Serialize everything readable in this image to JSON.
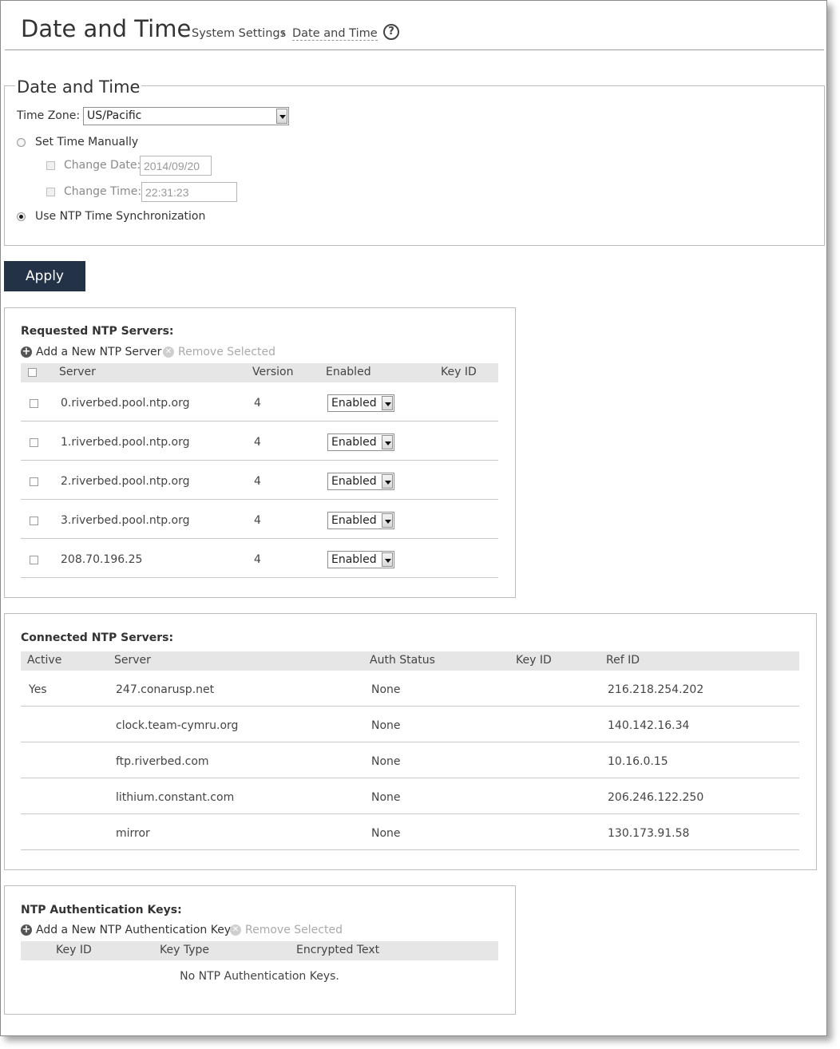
{
  "header": {
    "title": "Date and Time",
    "breadcrumb_parent": "System Settings",
    "breadcrumb_separator": "›",
    "breadcrumb_current": "Date and Time",
    "help_symbol": "?"
  },
  "date_time": {
    "legend": "Date and Time",
    "time_zone_label": "Time Zone:",
    "time_zone_value": "US/Pacific",
    "set_manually_label": "Set Time Manually",
    "change_date_label": "Change Date:",
    "change_date_value": "2014/09/20",
    "change_time_label": "Change Time:",
    "change_time_value": "22:31:23",
    "ntp_sync_label": "Use NTP Time Synchronization",
    "selected_mode": "ntp"
  },
  "apply_label": "Apply",
  "requested": {
    "title": "Requested NTP Servers:",
    "add_label": "Add a New NTP Server",
    "remove_label": "Remove Selected",
    "columns": [
      "Server",
      "Version",
      "Enabled",
      "Key ID"
    ],
    "rows": [
      {
        "server": "0.riverbed.pool.ntp.org",
        "version": "4",
        "enabled": "Enabled",
        "key_id": ""
      },
      {
        "server": "1.riverbed.pool.ntp.org",
        "version": "4",
        "enabled": "Enabled",
        "key_id": ""
      },
      {
        "server": "2.riverbed.pool.ntp.org",
        "version": "4",
        "enabled": "Enabled",
        "key_id": ""
      },
      {
        "server": "3.riverbed.pool.ntp.org",
        "version": "4",
        "enabled": "Enabled",
        "key_id": ""
      },
      {
        "server": "208.70.196.25",
        "version": "4",
        "enabled": "Enabled",
        "key_id": ""
      }
    ]
  },
  "connected": {
    "title": "Connected NTP Servers:",
    "columns": [
      "Active",
      "Server",
      "Auth Status",
      "Key ID",
      "Ref ID"
    ],
    "rows": [
      {
        "active": "Yes",
        "server": "247.conarusp.net",
        "auth": "None",
        "key_id": "",
        "ref_id": "216.218.254.202"
      },
      {
        "active": "",
        "server": "clock.team-cymru.org",
        "auth": "None",
        "key_id": "",
        "ref_id": "140.142.16.34"
      },
      {
        "active": "",
        "server": "ftp.riverbed.com",
        "auth": "None",
        "key_id": "",
        "ref_id": "10.16.0.15"
      },
      {
        "active": "",
        "server": "lithium.constant.com",
        "auth": "None",
        "key_id": "",
        "ref_id": "206.246.122.250"
      },
      {
        "active": "",
        "server": "mirror",
        "auth": "None",
        "key_id": "",
        "ref_id": "130.173.91.58"
      }
    ]
  },
  "auth_keys": {
    "title": "NTP Authentication Keys:",
    "add_label": "Add a New NTP Authentication Key",
    "remove_label": "Remove Selected",
    "columns": [
      "Key ID",
      "Key Type",
      "Encrypted Text"
    ],
    "empty_text": "No NTP Authentication Keys."
  },
  "colors": {
    "apply_button": "#243247",
    "table_header": "#e6e6e6",
    "border": "#bdbdbd"
  }
}
